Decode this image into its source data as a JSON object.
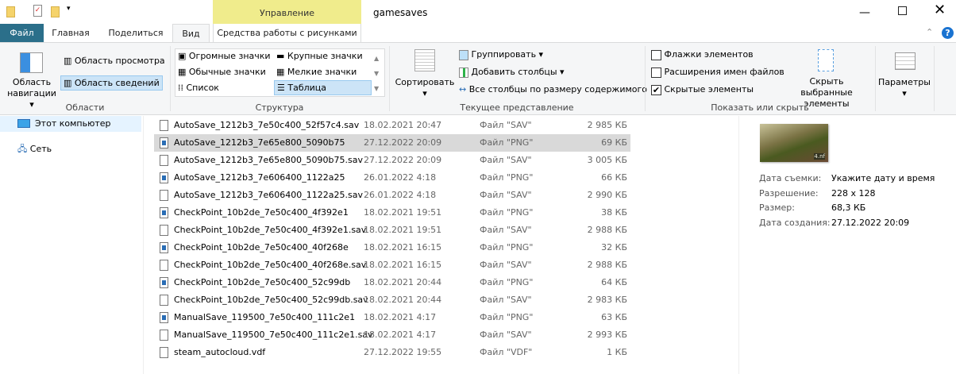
{
  "window": {
    "title": "gamesaves",
    "context_group": "Управление",
    "context_tab": "Средства работы с рисунками"
  },
  "tabs": [
    {
      "label": "Файл"
    },
    {
      "label": "Главная"
    },
    {
      "label": "Поделиться"
    },
    {
      "label": "Вид"
    }
  ],
  "ribbon": {
    "areas": {
      "nav_pane": "Область навигации",
      "preview": "Область просмотра",
      "details": "Область сведений",
      "label": "Области"
    },
    "layout": {
      "items": [
        "Огромные значки",
        "Крупные значки",
        "Обычные значки",
        "Мелкие значки",
        "Список",
        "Таблица"
      ],
      "selected": "Таблица",
      "label": "Структура"
    },
    "view": {
      "sort": "Сортировать",
      "group": "Группировать",
      "add_cols": "Добавить столбцы",
      "fit_cols": "Все столбцы по размеру содержимого",
      "label": "Текущее представление"
    },
    "show": {
      "checkboxes": "Флажки элементов",
      "extensions": "Расширения имен файлов",
      "hidden": "Скрытые элементы",
      "hide_selected": "Скрыть выбранные элементы",
      "label": "Показать или скрыть",
      "checkboxes_checked": false,
      "extensions_checked": false,
      "hidden_checked": true
    },
    "options": "Параметры"
  },
  "nav": [
    {
      "label": "Этот компьютер"
    },
    {
      "label": "Сеть"
    }
  ],
  "files": [
    {
      "name": "AutoSave_1212b3_7e50c400_52f57c4.sav",
      "date": "18.02.2021 20:47",
      "type": "Файл \"SAV\"",
      "size": "2 985 КБ",
      "icon": "file"
    },
    {
      "name": "AutoSave_1212b3_7e65e800_5090b75",
      "date": "27.12.2022 20:09",
      "type": "Файл \"PNG\"",
      "size": "69 КБ",
      "icon": "png"
    },
    {
      "name": "AutoSave_1212b3_7e65e800_5090b75.sav",
      "date": "27.12.2022 20:09",
      "type": "Файл \"SAV\"",
      "size": "3 005 КБ",
      "icon": "file"
    },
    {
      "name": "AutoSave_1212b3_7e606400_1122a25",
      "date": "26.01.2022 4:18",
      "type": "Файл \"PNG\"",
      "size": "66 КБ",
      "icon": "png"
    },
    {
      "name": "AutoSave_1212b3_7e606400_1122a25.sav",
      "date": "26.01.2022 4:18",
      "type": "Файл \"SAV\"",
      "size": "2 990 КБ",
      "icon": "file"
    },
    {
      "name": "CheckPoint_10b2de_7e50c400_4f392e1",
      "date": "18.02.2021 19:51",
      "type": "Файл \"PNG\"",
      "size": "38 КБ",
      "icon": "png"
    },
    {
      "name": "CheckPoint_10b2de_7e50c400_4f392e1.sav",
      "date": "18.02.2021 19:51",
      "type": "Файл \"SAV\"",
      "size": "2 988 КБ",
      "icon": "file"
    },
    {
      "name": "CheckPoint_10b2de_7e50c400_40f268e",
      "date": "18.02.2021 16:15",
      "type": "Файл \"PNG\"",
      "size": "32 КБ",
      "icon": "png"
    },
    {
      "name": "CheckPoint_10b2de_7e50c400_40f268e.sav",
      "date": "18.02.2021 16:15",
      "type": "Файл \"SAV\"",
      "size": "2 988 КБ",
      "icon": "file"
    },
    {
      "name": "CheckPoint_10b2de_7e50c400_52c99db",
      "date": "18.02.2021 20:44",
      "type": "Файл \"PNG\"",
      "size": "64 КБ",
      "icon": "png"
    },
    {
      "name": "CheckPoint_10b2de_7e50c400_52c99db.sav",
      "date": "18.02.2021 20:44",
      "type": "Файл \"SAV\"",
      "size": "2 983 КБ",
      "icon": "file"
    },
    {
      "name": "ManualSave_119500_7e50c400_111c2e1",
      "date": "18.02.2021 4:17",
      "type": "Файл \"PNG\"",
      "size": "63 КБ",
      "icon": "png"
    },
    {
      "name": "ManualSave_119500_7e50c400_111c2e1.sav",
      "date": "18.02.2021 4:17",
      "type": "Файл \"SAV\"",
      "size": "2 993 КБ",
      "icon": "file"
    },
    {
      "name": "steam_autocloud.vdf",
      "date": "27.12.2022 19:55",
      "type": "Файл \"VDF\"",
      "size": "1 КБ",
      "icon": "file"
    }
  ],
  "selected_index": 1,
  "details": {
    "thumb_text": "4.nf",
    "fields": [
      {
        "k": "Дата съемки:",
        "v": "Укажите дату и время"
      },
      {
        "k": "Разрешение:",
        "v": "228 x 128"
      },
      {
        "k": "Размер:",
        "v": "68,3 КБ"
      },
      {
        "k": "Дата создания:",
        "v": "27.12.2022 20:09"
      }
    ]
  }
}
